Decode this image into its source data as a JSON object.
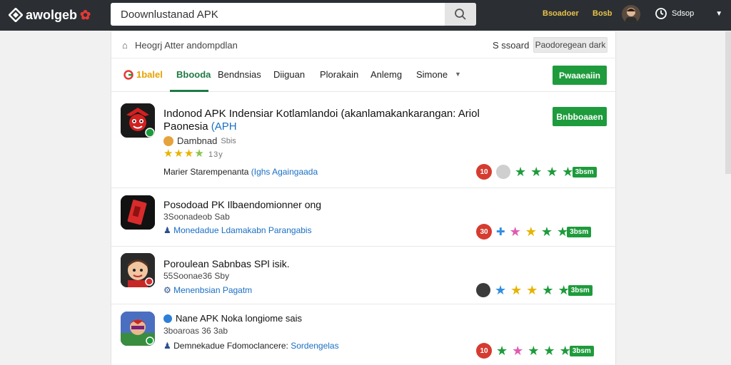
{
  "header": {
    "logo_text": "awolgeb",
    "search_value": "Doownlustanad APK",
    "search_placeholder": "",
    "top_link_1": "Bsoadoer",
    "top_link_2": "Bosb",
    "user_label": "Sdsop"
  },
  "breadcrumb": {
    "text": "Heogrj  Atter  andompdlan",
    "right_label": "S ssoard",
    "button_label": "Paodoregean dark"
  },
  "tabs": {
    "brand_label": "1balel",
    "items": [
      "Bbooda",
      "Bendnsias",
      "Diiguan",
      "Plorakain",
      "Anlemg",
      "Simone"
    ],
    "action_label": "Pwaaeaiin"
  },
  "apps": [
    {
      "title_line1": "Indonod APK Indensiar Kotlamlandoi (akanlamakankarangan: Ariol",
      "title_line2_a": "Paonesia",
      "title_line2_b": "(APH",
      "developer": "Dambnad",
      "meta": "Sbis",
      "reviews": "13y",
      "desc_a": "Marier Starempenanta",
      "desc_b": "(Ighs Againgaada",
      "badge": "10",
      "score": "3bsm",
      "button": "Bnbboaaen"
    },
    {
      "title": "Posodoad PK Ilbaendomionner ong",
      "sub": "3Soonadeob Sab",
      "desc": "Monedadue Ldamakabn Parangabis",
      "badge": "30",
      "score": "3bsm"
    },
    {
      "title": "Poroulean Sabnbas  SPl isik.",
      "sub": "55Soonae36  Sby",
      "desc": "Menenbsian Pagatm",
      "score": "3bsm"
    },
    {
      "title": "Nane APK Noka longiome sais",
      "sub": "3boaroas 36   3ab",
      "desc_a": "Demnekadue Fdomoclancere:",
      "desc_b": "Sordengelas",
      "badge": "10",
      "score": "3bsm"
    }
  ],
  "colors": {
    "topbar": "#2b2f33",
    "accent_green": "#1e9b3c",
    "tab_active": "#1f7a45",
    "link_blue": "#1a6fc4",
    "badge_red": "#d63b2f"
  }
}
